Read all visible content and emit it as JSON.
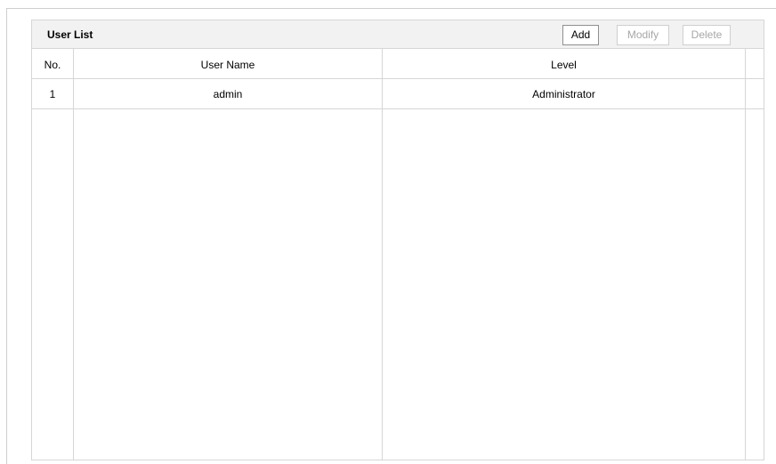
{
  "panel": {
    "title": "User List",
    "buttons": {
      "add": "Add",
      "modify": "Modify",
      "delete": "Delete"
    }
  },
  "table": {
    "columns": [
      "No.",
      "User Name",
      "Level"
    ],
    "rows": [
      {
        "no": "1",
        "user_name": "admin",
        "level": "Administrator"
      }
    ]
  }
}
